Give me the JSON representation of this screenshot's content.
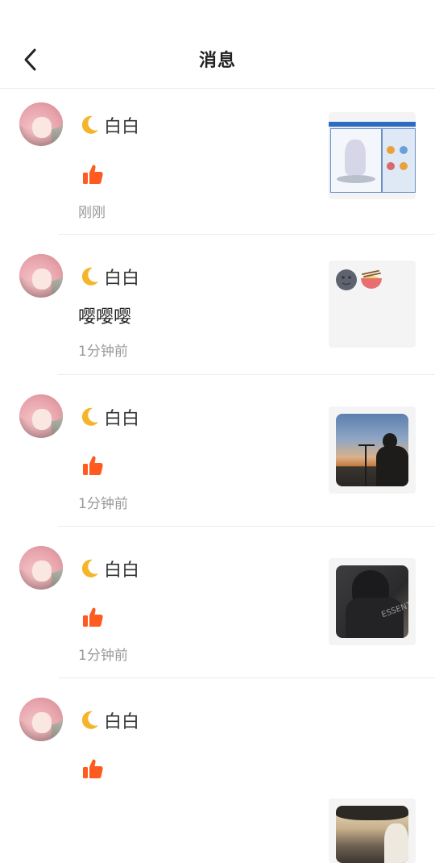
{
  "header": {
    "title": "消息"
  },
  "messages": [
    {
      "name": "白白",
      "type": "like",
      "text": "",
      "time": "刚刚",
      "thumb": "screenshot"
    },
    {
      "name": "白白",
      "type": "comment",
      "text": "嘤嘤嘤",
      "time": "1分钟前",
      "thumb": "emoji"
    },
    {
      "name": "白白",
      "type": "like",
      "text": "",
      "time": "1分钟前",
      "thumb": "sunset-photo"
    },
    {
      "name": "白白",
      "type": "like",
      "text": "",
      "time": "1分钟前",
      "thumb": "hoodie-photo"
    },
    {
      "name": "白白",
      "type": "like",
      "text": "",
      "time": "",
      "thumb": "car-photo"
    }
  ],
  "thumb_emoji": [
    "🌚",
    "🍜"
  ],
  "icons": {
    "back": "chevron-left-icon",
    "moon": "crescent-moon-icon",
    "like": "thumbs-up-icon"
  },
  "colors": {
    "like": "#ff5a1f",
    "moon": "#f5b52a",
    "time": "#999999",
    "divider": "#ececec"
  }
}
